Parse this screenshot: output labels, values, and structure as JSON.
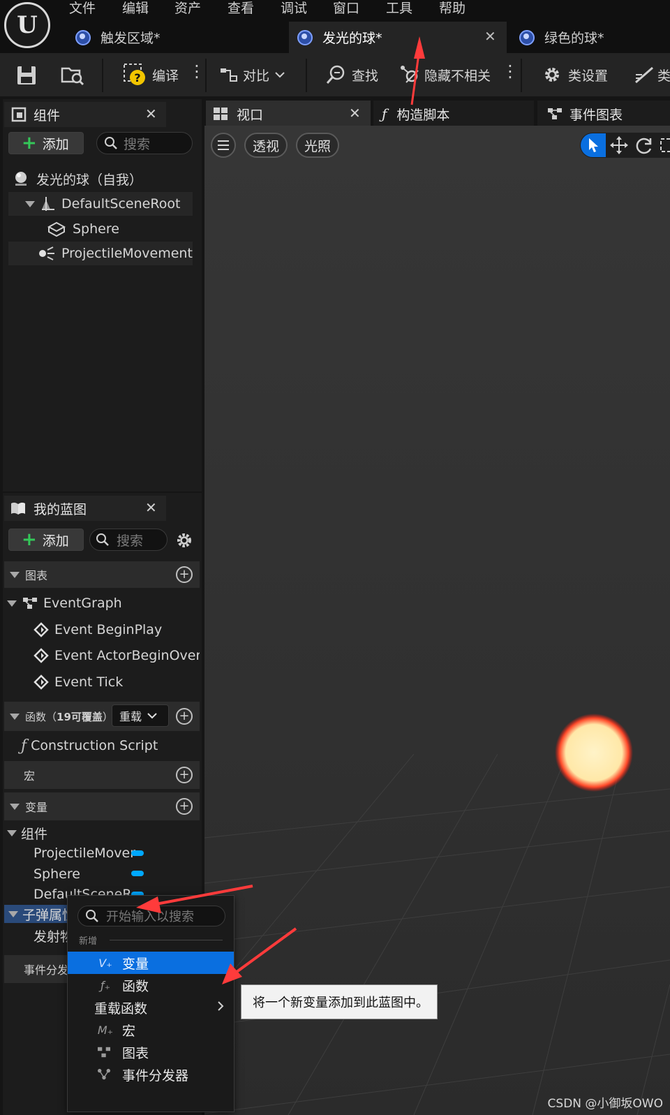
{
  "menu": [
    "文件",
    "编辑",
    "资产",
    "查看",
    "调试",
    "窗口",
    "工具",
    "帮助"
  ],
  "doc_tabs": [
    {
      "label": "触发区域*"
    },
    {
      "label": "发光的球*"
    },
    {
      "label": "绿色的球*"
    }
  ],
  "toolbar": {
    "compile": "编译",
    "diff": "对比",
    "find": "查找",
    "hide_unrelated": "隐藏不相关",
    "class_settings": "类设置",
    "class_defaults_partial": "类"
  },
  "components_panel": {
    "title": "组件",
    "add_label": "添加",
    "search_placeholder": "搜索",
    "items": [
      {
        "label": "发光的球（自我）"
      },
      {
        "label": "DefaultSceneRoot"
      },
      {
        "label": "Sphere"
      },
      {
        "label": "ProjectileMovement"
      }
    ]
  },
  "editor_tabs": {
    "viewport": "视口",
    "construction_script": "构造脚本",
    "event_graph": "事件图表"
  },
  "viewport": {
    "perspective": "透视",
    "lit": "光照"
  },
  "my_blueprint": {
    "title": "我的蓝图",
    "add_label": "添加",
    "search_placeholder": "搜索",
    "graphs_header": "图表",
    "event_graph": "EventGraph",
    "events": [
      "Event BeginPlay",
      "Event ActorBeginOverla",
      "Event Tick"
    ],
    "functions_header": "函数（",
    "functions_count": "19可覆盖",
    "functions_paren_close": "）",
    "override_label": "重载",
    "construction_script": "Construction Script",
    "macros_header": "宏",
    "variables_header": "变量",
    "components_category": "组件",
    "component_vars": [
      "ProjectileMover",
      "Sphere",
      "DefaultSceneR"
    ],
    "bullet_category": "子弹属性",
    "bullet_var_partial": "发射物",
    "dispatchers_partial": "事件分发"
  },
  "context_menu": {
    "search_placeholder": "开始输入以搜索",
    "section_label": "新增",
    "items": [
      {
        "label": "变量",
        "icon": "variable-icon"
      },
      {
        "label": "函数",
        "icon": "function-icon"
      },
      {
        "label": "重载函数",
        "icon": ""
      },
      {
        "label": "宏",
        "icon": "macro-icon"
      },
      {
        "label": "图表",
        "icon": "graph-icon"
      },
      {
        "label": "事件分发器",
        "icon": "dispatcher-icon"
      }
    ]
  },
  "tooltip": "将一个新变量添加到此蓝图中。",
  "watermark": "CSDN @小御坂OWO",
  "colors": {
    "selection": "#0a6fe0",
    "annotation_arrow": "#ff3b3b",
    "variable_pin": "#00a8ff",
    "add_plus": "#34c759"
  }
}
